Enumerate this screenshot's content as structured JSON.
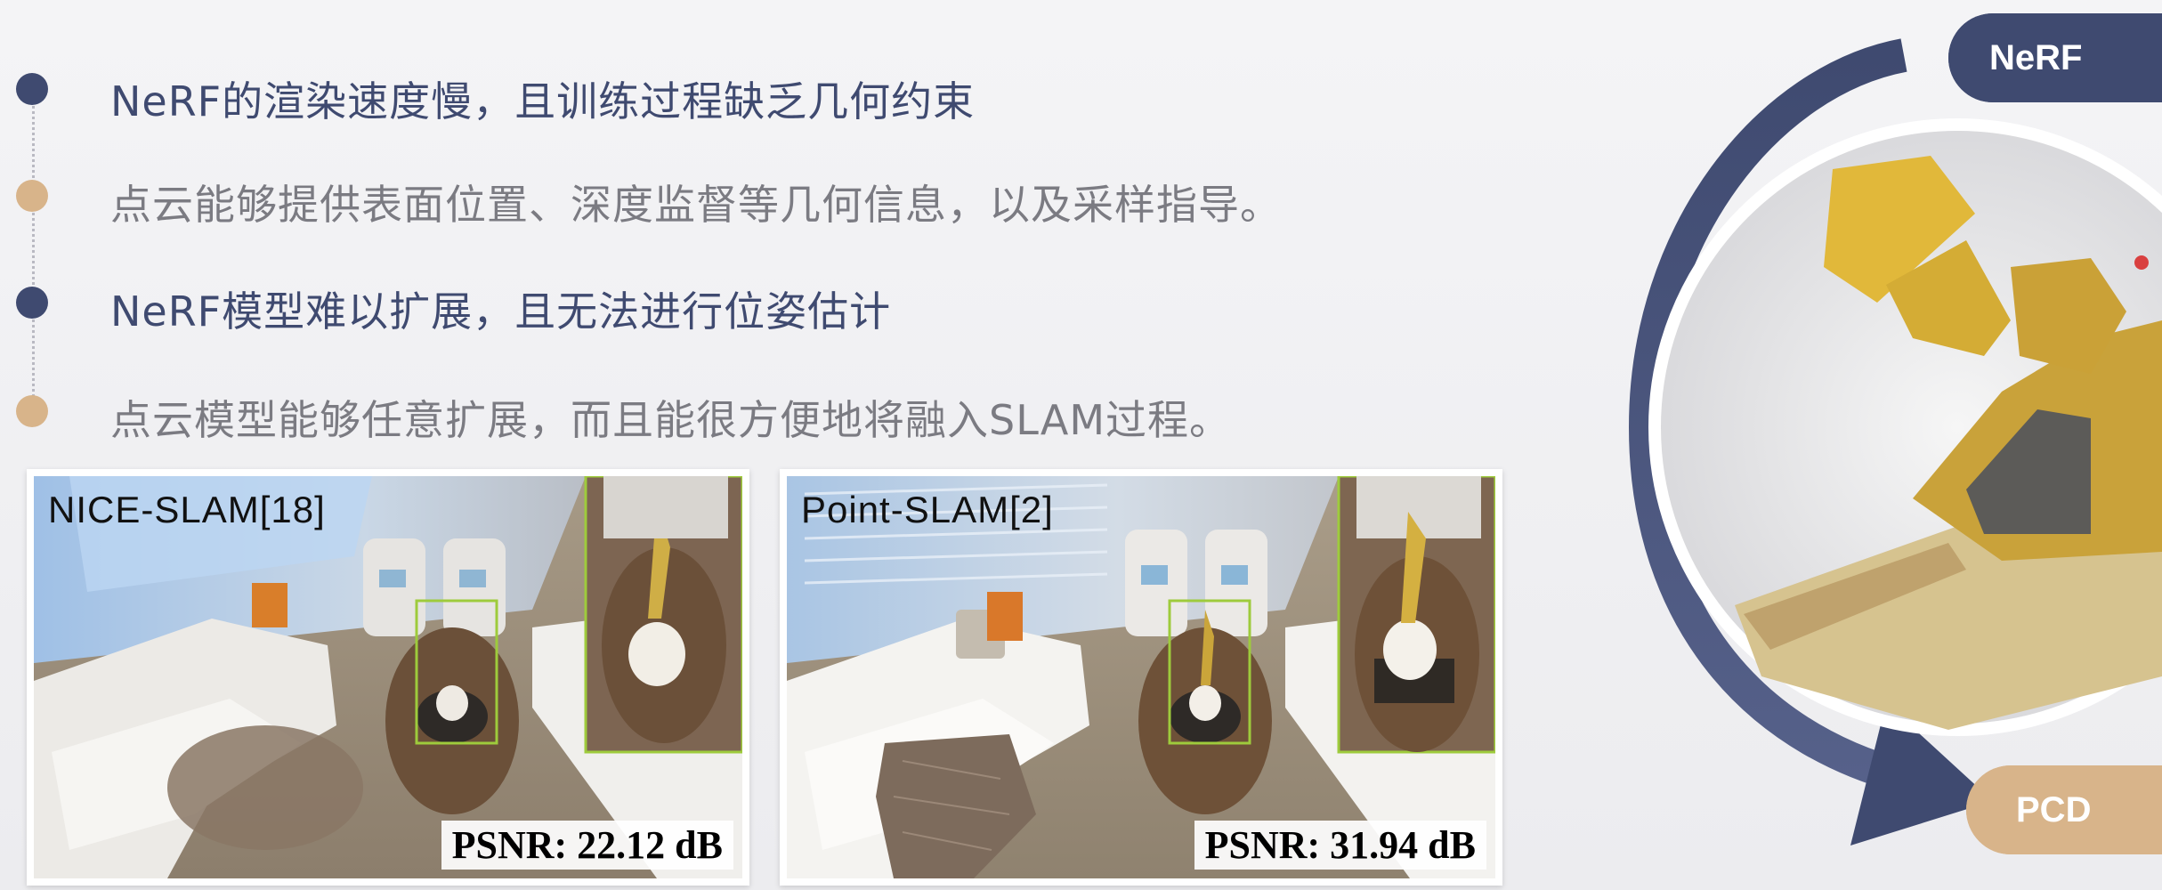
{
  "bullets": [
    {
      "text": "NeRF的渲染速度慢，且训练过程缺乏几何约束",
      "style": "dark"
    },
    {
      "text": "点云能够提供表面位置、深度监督等几何信息，以及采样指导。",
      "style": "gray"
    },
    {
      "text": "NeRF模型难以扩展，且无法进行位姿估计",
      "style": "dark"
    },
    {
      "text": "点云模型能够任意扩展，而且能很方便地将融入SLAM过程。",
      "style": "gray"
    }
  ],
  "panels": {
    "left": {
      "label": "NICE-SLAM[18]",
      "psnr": "PSNR: 22.12 dB"
    },
    "right": {
      "label": "Point-SLAM[2]",
      "psnr": "PSNR: 31.94 dB"
    }
  },
  "cycle": {
    "top_label": "NeRF",
    "bottom_label": "PCD"
  },
  "colors": {
    "dark": "#3f4a70",
    "tan": "#d8b48a"
  }
}
